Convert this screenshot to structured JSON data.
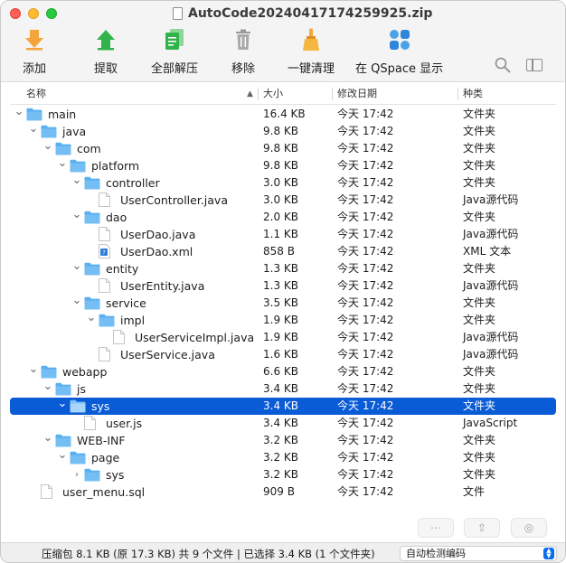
{
  "window": {
    "title": "AutoCode20240417174259925.zip"
  },
  "toolbar": {
    "add": "添加",
    "extract": "提取",
    "extract_all": "全部解压",
    "remove": "移除",
    "clean": "一键清理",
    "qspace": "在 QSpace 显示"
  },
  "columns": {
    "name": "名称",
    "size": "大小",
    "date": "修改日期",
    "kind": "种类"
  },
  "rows": [
    {
      "name": "main",
      "depth": 0,
      "type": "folder",
      "expanded": true,
      "size": "16.4 KB",
      "date": "今天 17:42",
      "kind": "文件夹"
    },
    {
      "name": "java",
      "depth": 1,
      "type": "folder",
      "expanded": true,
      "size": "9.8 KB",
      "date": "今天 17:42",
      "kind": "文件夹"
    },
    {
      "name": "com",
      "depth": 2,
      "type": "folder",
      "expanded": true,
      "size": "9.8 KB",
      "date": "今天 17:42",
      "kind": "文件夹"
    },
    {
      "name": "platform",
      "depth": 3,
      "type": "folder",
      "expanded": true,
      "size": "9.8 KB",
      "date": "今天 17:42",
      "kind": "文件夹"
    },
    {
      "name": "controller",
      "depth": 4,
      "type": "folder",
      "expanded": true,
      "size": "3.0 KB",
      "date": "今天 17:42",
      "kind": "文件夹"
    },
    {
      "name": "UserController.java",
      "depth": 5,
      "type": "file",
      "size": "3.0 KB",
      "date": "今天 17:42",
      "kind": "Java源代码"
    },
    {
      "name": "dao",
      "depth": 4,
      "type": "folder",
      "expanded": true,
      "size": "2.0 KB",
      "date": "今天 17:42",
      "kind": "文件夹"
    },
    {
      "name": "UserDao.java",
      "depth": 5,
      "type": "file",
      "size": "1.1 KB",
      "date": "今天 17:42",
      "kind": "Java源代码"
    },
    {
      "name": "UserDao.xml",
      "depth": 5,
      "type": "xml",
      "size": "858 B",
      "date": "今天 17:42",
      "kind": "XML 文本"
    },
    {
      "name": "entity",
      "depth": 4,
      "type": "folder",
      "expanded": true,
      "size": "1.3 KB",
      "date": "今天 17:42",
      "kind": "文件夹"
    },
    {
      "name": "UserEntity.java",
      "depth": 5,
      "type": "file",
      "size": "1.3 KB",
      "date": "今天 17:42",
      "kind": "Java源代码"
    },
    {
      "name": "service",
      "depth": 4,
      "type": "folder",
      "expanded": true,
      "size": "3.5 KB",
      "date": "今天 17:42",
      "kind": "文件夹"
    },
    {
      "name": "impl",
      "depth": 5,
      "type": "folder",
      "expanded": true,
      "size": "1.9 KB",
      "date": "今天 17:42",
      "kind": "文件夹"
    },
    {
      "name": "UserServiceImpl.java",
      "depth": 6,
      "type": "file",
      "size": "1.9 KB",
      "date": "今天 17:42",
      "kind": "Java源代码"
    },
    {
      "name": "UserService.java",
      "depth": 5,
      "type": "file",
      "size": "1.6 KB",
      "date": "今天 17:42",
      "kind": "Java源代码"
    },
    {
      "name": "webapp",
      "depth": 1,
      "type": "folder",
      "expanded": true,
      "size": "6.6 KB",
      "date": "今天 17:42",
      "kind": "文件夹"
    },
    {
      "name": "js",
      "depth": 2,
      "type": "folder",
      "expanded": true,
      "size": "3.4 KB",
      "date": "今天 17:42",
      "kind": "文件夹"
    },
    {
      "name": "sys",
      "depth": 3,
      "type": "folder",
      "expanded": true,
      "selected": true,
      "size": "3.4 KB",
      "date": "今天 17:42",
      "kind": "文件夹"
    },
    {
      "name": "user.js",
      "depth": 4,
      "type": "file",
      "size": "3.4 KB",
      "date": "今天 17:42",
      "kind": "JavaScript"
    },
    {
      "name": "WEB-INF",
      "depth": 2,
      "type": "folder",
      "expanded": true,
      "size": "3.2 KB",
      "date": "今天 17:42",
      "kind": "文件夹"
    },
    {
      "name": "page",
      "depth": 3,
      "type": "folder",
      "expanded": true,
      "size": "3.2 KB",
      "date": "今天 17:42",
      "kind": "文件夹"
    },
    {
      "name": "sys",
      "depth": 4,
      "type": "folder",
      "expanded": false,
      "size": "3.2 KB",
      "date": "今天 17:42",
      "kind": "文件夹"
    },
    {
      "name": "user_menu.sql",
      "depth": 1,
      "type": "file",
      "size": "909 B",
      "date": "今天 17:42",
      "kind": "文件"
    }
  ],
  "status": {
    "text": "压缩包 8.1 KB (原 17.3 KB) 共 9 个文件  |  已选择 3.4 KB (1 个文件夹)",
    "encoding": "自动检测编码"
  },
  "colors": {
    "accent": "#0a5bd6",
    "folder": "#5ab0f0",
    "add_icon": "#f2a03a",
    "extract_icon": "#2fb34a"
  }
}
